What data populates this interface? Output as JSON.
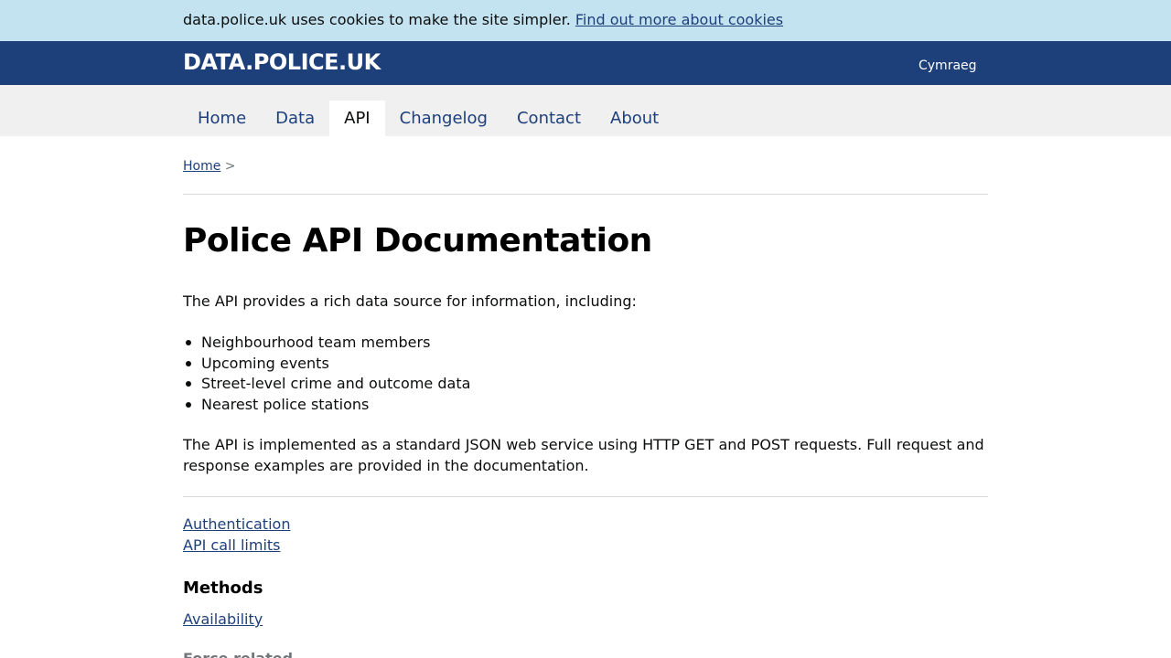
{
  "cookie_banner": {
    "message": "data.police.uk uses cookies to make the site simpler.",
    "link_text": "Find out more about cookies"
  },
  "header": {
    "logo": "DATA.POLICE.UK",
    "language_link": "Cymraeg"
  },
  "nav": {
    "items": [
      {
        "label": "Home",
        "active": false
      },
      {
        "label": "Data",
        "active": false
      },
      {
        "label": "API",
        "active": true
      },
      {
        "label": "Changelog",
        "active": false
      },
      {
        "label": "Contact",
        "active": false
      },
      {
        "label": "About",
        "active": false
      }
    ]
  },
  "breadcrumb": {
    "home": "Home",
    "separator": ">"
  },
  "main": {
    "title": "Police API Documentation",
    "intro": "The API provides a rich data source for information, including:",
    "features": [
      "Neighbourhood team members",
      "Upcoming events",
      "Street-level crime and outcome data",
      "Nearest police stations"
    ],
    "description": "The API is implemented as a standard JSON web service using HTTP GET and POST requests. Full request and response examples are provided in the documentation.",
    "links": [
      "Authentication",
      "API call limits"
    ],
    "methods_heading": "Methods",
    "methods_links": [
      "Availability"
    ],
    "next_heading": "Force related"
  },
  "colors": {
    "cookie_bg": "#c4e3f0",
    "header_bg": "#1d3f7a",
    "nav_bg": "#f0f0f0",
    "link": "#1d3f7a"
  }
}
